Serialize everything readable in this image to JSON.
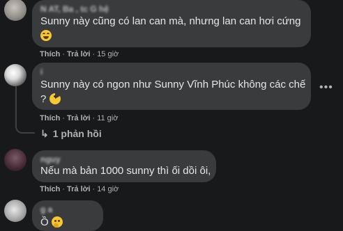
{
  "comments": [
    {
      "author": "N   AT, Ba    ,  tc   G     hệ",
      "lines": [
        "Sunny này cũng có lan can mà, nhưng lan can hơi cứng",
        ""
      ],
      "emoji": "laughing-tears",
      "actions": {
        "like": "Thích",
        "reply": "Trả lời",
        "time": "15 giờ"
      }
    },
    {
      "author": "     i",
      "lines": [
        "Sunny này có ngon như Sunny Vĩnh Phúc không các chế",
        "?"
      ],
      "emoji": "pacman",
      "actions": {
        "like": "Thích",
        "reply": "Trả lời",
        "time": "11 giờ"
      }
    },
    {
      "author": "   nguy  ",
      "lines": [
        "Nếu mà bản 1000 sunny thì ối dồi ôi,"
      ],
      "actions": {
        "like": "Thích",
        "reply": "Trả lời",
        "time": "14 giờ"
      }
    },
    {
      "author": "    g    a",
      "lines": [
        "Ồ"
      ],
      "emoji": "thinking-face"
    }
  ],
  "thread": {
    "replies_label": "1 phản hồi",
    "arrow_icon": "reply-arrow-icon"
  },
  "more_icon": "more-options-icon",
  "colors": {
    "background": "#18191a",
    "bubble": "#3a3b3c",
    "text": "#e4e6eb",
    "muted": "#b0b3b8"
  }
}
